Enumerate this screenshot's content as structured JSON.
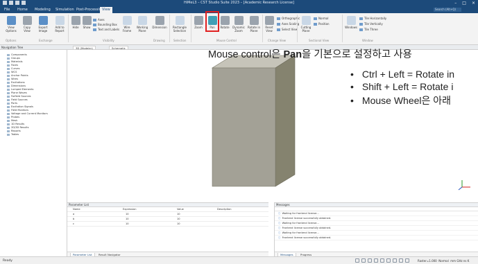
{
  "window": {
    "title": "HiMeL3 – CST Studio Suite 2023 – [Academic Research License]"
  },
  "menubar": {
    "tabs": [
      "File",
      "Home",
      "Modeling",
      "Simulation",
      "Post-Processing",
      "View"
    ],
    "active_tab": "View",
    "search_placeholder": "Search (Alt+Q)"
  },
  "ribbon": {
    "buttons": [
      {
        "label": "View Options",
        "icon": "view-options-icon"
      },
      {
        "label": "Copy View",
        "icon": "copy-view-icon"
      },
      {
        "label": "Export Image",
        "icon": "export-image-icon"
      },
      {
        "label": "Add to Report",
        "icon": "add-to-report-icon"
      },
      {
        "label": "Hide",
        "icon": "hide-icon"
      },
      {
        "label": "Show",
        "icon": "show-icon"
      },
      {
        "label": "Wire Frame",
        "icon": "wire-frame-icon"
      },
      {
        "label": "Working Plane",
        "icon": "working-plane-icon"
      },
      {
        "label": "Dimension",
        "icon": "dimension-icon"
      },
      {
        "label": "Rectangle Selection",
        "icon": "rectangle-selection-icon"
      },
      {
        "label": "Zoom",
        "icon": "zoom-icon"
      },
      {
        "label": "Pan",
        "icon": "pan-icon"
      },
      {
        "label": "Rotate",
        "icon": "rotate-icon"
      },
      {
        "label": "Dynamic Zoom",
        "icon": "dynamic-zoom-icon"
      },
      {
        "label": "Rotate in Plane",
        "icon": "rotate-in-plane-icon"
      },
      {
        "label": "Reset View",
        "icon": "reset-view-icon"
      },
      {
        "label": "Cutting Plane",
        "icon": "cutting-plane-icon"
      },
      {
        "label": "Windows",
        "icon": "windows-icon"
      }
    ],
    "small_items": [
      "Axes",
      "Bounding Box",
      "Text and Labels",
      "Orthographic",
      "Axes Scaling",
      "Select View",
      "Normal",
      "Position",
      "Tile Horizontally",
      "Tile Vertically",
      "Tile Three"
    ],
    "groups": [
      "Options",
      "Exchange",
      "Visibility",
      "Drawing",
      "Selection",
      "Mouse Control",
      "Change View",
      "Sectional View",
      "Window"
    ]
  },
  "annotation": {
    "title_pre": "Mouse control은 ",
    "title_bold": "Pan",
    "title_post": "을 기본으로 설정하고 사용",
    "bullets": [
      "Ctrl + Left = Rotate in",
      "Shift + Left = Rotate i",
      "Mouse Wheel은 아래"
    ]
  },
  "navigation": {
    "header": "Navigation Tree",
    "items": [
      "Components",
      "Groups",
      "Materials",
      "Faces",
      "Curves",
      "WCS",
      "Anchor Points",
      "Wires",
      "Excitations",
      "Dimensions",
      "Lumped Elements",
      "Plane Waves",
      "Farfield Sources",
      "Field Sources",
      "Ports",
      "Excitation Signals",
      "Field Monitors",
      "Voltage and Current Monitors",
      "Probes",
      "Mesh",
      "1D Results",
      "2D/3D Results",
      "Reports",
      "Tables"
    ]
  },
  "doc_tabs": [
    "3D (Modeler)",
    "Schematic"
  ],
  "parameter_list": {
    "title": "Parameter List",
    "columns": [
      "Name",
      "Expression",
      "Value",
      "Description"
    ],
    "rows": [
      {
        "name": "a",
        "expression": "10",
        "value": "10"
      },
      {
        "name": "b",
        "expression": "10",
        "value": "10"
      },
      {
        "name": "c",
        "expression": "10",
        "value": "10"
      }
    ],
    "tabs": [
      "Parameter List",
      "Result Navigator"
    ]
  },
  "messages": {
    "title": "Messages",
    "items": [
      "Waiting for frontend license...",
      "Frontend license successfully obtained.",
      "Waiting for frontend license...",
      "Frontend license successfully obtained.",
      "Waiting for frontend license...",
      "Frontend license successfully obtained."
    ],
    "tabs": [
      "Messages",
      "Progress"
    ]
  },
  "status": {
    "ready": "Ready",
    "raster": "Raster=1.000",
    "mode": "Normal",
    "units": "mm GHz ns K"
  },
  "colors": {
    "titlebar": "#1c4a7a",
    "cube_front": "#a3a196",
    "cube_top": "#c6c4b9",
    "cube_side": "#85836f",
    "highlight": "#e02020"
  }
}
